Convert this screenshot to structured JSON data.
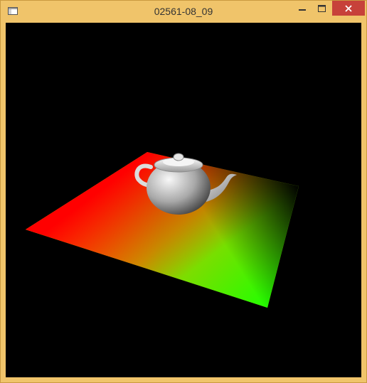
{
  "window": {
    "title": "02561-08_09",
    "frame_color": "#f0c46a",
    "close_button_color": "#c7413a",
    "icons": {
      "app": "app-window-icon",
      "minimize": "minimize-icon",
      "maximize": "maximize-icon",
      "close": "close-icon"
    }
  },
  "scene": {
    "background": "#000000",
    "floor_corner_colors": [
      "#ff0000",
      "#00ff00",
      "#ffcc00",
      "#000000"
    ],
    "object": "teapot"
  }
}
